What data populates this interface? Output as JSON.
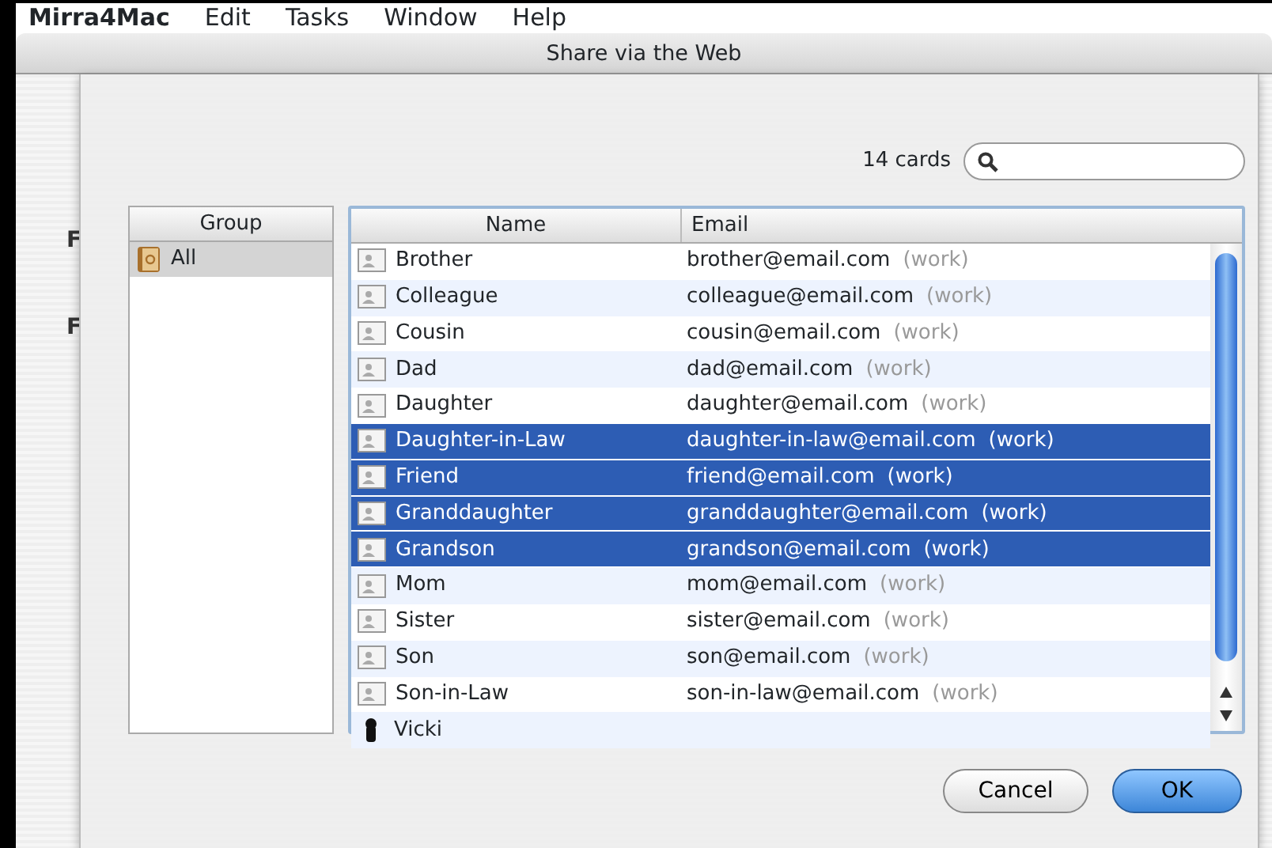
{
  "menu_bar": {
    "app": "Mirra4Mac",
    "items": [
      "Edit",
      "Tasks",
      "Window",
      "Help"
    ]
  },
  "window": {
    "title": "Share via the Web",
    "background_labels": [
      "F",
      "F"
    ]
  },
  "sheet": {
    "count": "14 cards",
    "groups": {
      "column": "Group",
      "items": [
        {
          "name": "All",
          "selected": true
        }
      ]
    },
    "contacts": {
      "columns": [
        "Name",
        "Email"
      ],
      "rows": [
        {
          "name": "Brother",
          "email": "brother@email.com",
          "label": "(work)",
          "kind": "card",
          "selected": false
        },
        {
          "name": "Colleague",
          "email": "colleague@email.com",
          "label": "(work)",
          "kind": "card",
          "selected": false
        },
        {
          "name": "Cousin",
          "email": "cousin@email.com",
          "label": "(work)",
          "kind": "card",
          "selected": false
        },
        {
          "name": "Dad",
          "email": "dad@email.com",
          "label": "(work)",
          "kind": "card",
          "selected": false
        },
        {
          "name": "Daughter",
          "email": "daughter@email.com",
          "label": "(work)",
          "kind": "card",
          "selected": false
        },
        {
          "name": "Daughter-in-Law",
          "email": "daughter-in-law@email.com",
          "label": "(work)",
          "kind": "card",
          "selected": true
        },
        {
          "name": "Friend",
          "email": "friend@email.com",
          "label": "(work)",
          "kind": "card",
          "selected": true
        },
        {
          "name": "Granddaughter",
          "email": "granddaughter@email.com",
          "label": "(work)",
          "kind": "card",
          "selected": true
        },
        {
          "name": "Grandson",
          "email": "grandson@email.com",
          "label": "(work)",
          "kind": "card",
          "selected": true
        },
        {
          "name": "Mom",
          "email": "mom@email.com",
          "label": "(work)",
          "kind": "card",
          "selected": false
        },
        {
          "name": "Sister",
          "email": "sister@email.com",
          "label": "(work)",
          "kind": "card",
          "selected": false
        },
        {
          "name": "Son",
          "email": "son@email.com",
          "label": "(work)",
          "kind": "card",
          "selected": false
        },
        {
          "name": "Son-in-Law",
          "email": "son-in-law@email.com",
          "label": "(work)",
          "kind": "card",
          "selected": false
        },
        {
          "name": "Vicki",
          "kind": "person",
          "selected": false
        }
      ]
    },
    "buttons": [
      {
        "label": "Cancel",
        "kind": "normal"
      },
      {
        "label": "OK",
        "kind": "default"
      }
    ]
  }
}
